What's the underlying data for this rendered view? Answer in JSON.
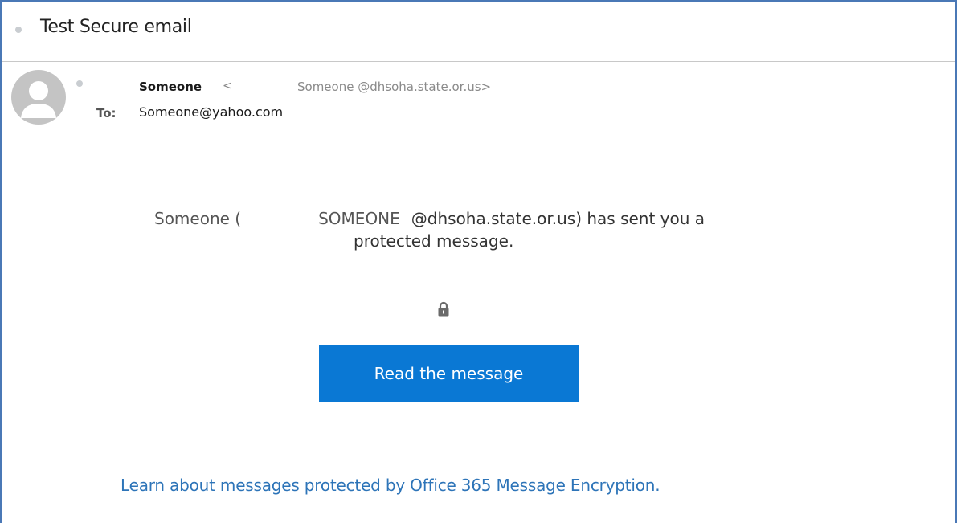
{
  "email": {
    "subject": "Test Secure email",
    "sender": {
      "name": "Someone",
      "separator": "<",
      "email": "Someone @dhsoha.state.or.us>"
    },
    "to": {
      "label": "To:",
      "value": "Someone@yahoo.com"
    }
  },
  "body": {
    "notice_name": "Someone (",
    "notice_upper": "SOMEONE",
    "notice_rest": "@dhsoha.state.or.us) has sent you a",
    "notice_line2": "protected message.",
    "read_button_label": "Read the message",
    "learn_link": "Learn about messages protected by Office 365 Message Encryption."
  },
  "icons": {
    "avatar": "person-avatar-icon",
    "lock": "lock-icon",
    "unread_dot": "dot-icon"
  },
  "colors": {
    "frame_border": "#4a78b6",
    "button_bg": "#0a78d4",
    "link": "#2d74b8"
  }
}
